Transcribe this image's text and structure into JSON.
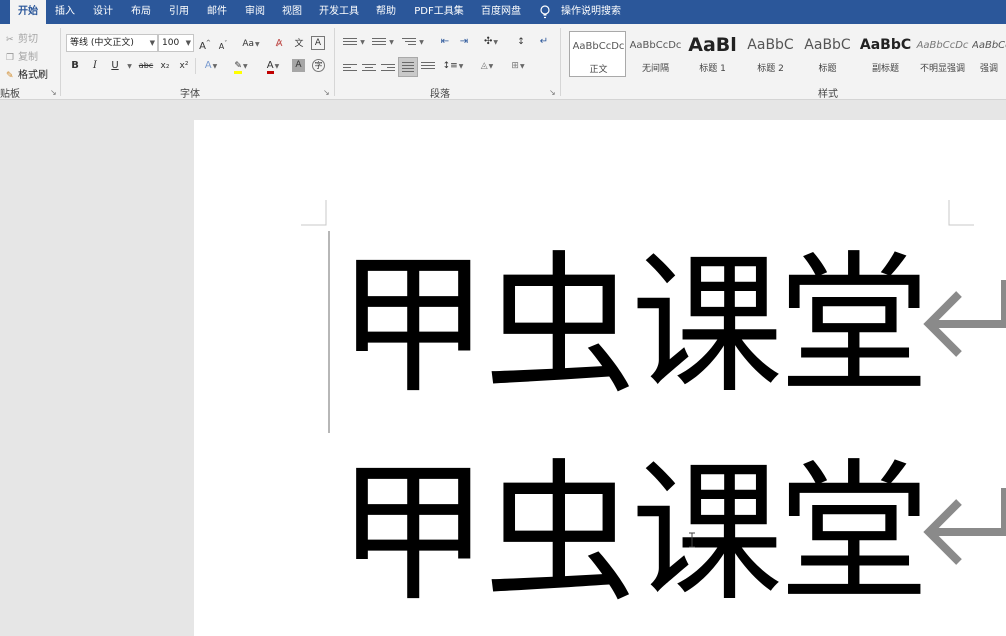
{
  "tabs": [
    "开始",
    "插入",
    "设计",
    "布局",
    "引用",
    "邮件",
    "审阅",
    "视图",
    "开发工具",
    "帮助",
    "PDF工具集",
    "百度网盘"
  ],
  "search": {
    "label": "操作说明搜索"
  },
  "clipboard": {
    "cut": "剪切",
    "copy": "复制",
    "format_painter": "格式刷",
    "group_label": "贴板"
  },
  "font": {
    "font_name": "等线 (中文正文)",
    "font_size": "100",
    "change_case": "Aa",
    "bold": "B",
    "italic": "I",
    "underline": "U",
    "strikethrough": "abc",
    "subscript": "x₂",
    "superscript": "x²",
    "char_shading": "A",
    "group_label": "字体",
    "colors": {
      "highlight": "#ffff00",
      "font_color": "#c00000"
    }
  },
  "paragraph": {
    "group_label": "段落"
  },
  "styles": {
    "group_label": "样式",
    "items": [
      {
        "sample": "AaBbCcDc",
        "name": "正文",
        "selected": true
      },
      {
        "sample": "AaBbCcDc",
        "name": "无间隔"
      },
      {
        "sample": "AaBl",
        "name": "标题 1"
      },
      {
        "sample": "AaBbC",
        "name": "标题 2"
      },
      {
        "sample": "AaBbC",
        "name": "标题"
      },
      {
        "sample": "AaBbC",
        "name": "副标题"
      },
      {
        "sample": "AaBbCcDc",
        "name": "不明显强调"
      },
      {
        "sample": "AaBbCc",
        "name": "强调"
      }
    ]
  },
  "document": {
    "lines": [
      "甲虫课堂",
      "甲虫课堂"
    ]
  },
  "colors": {
    "ribbon_tab": "#2b579a",
    "ribbon_body": "#f3f3f3",
    "canvas": "#e6e6e6"
  }
}
